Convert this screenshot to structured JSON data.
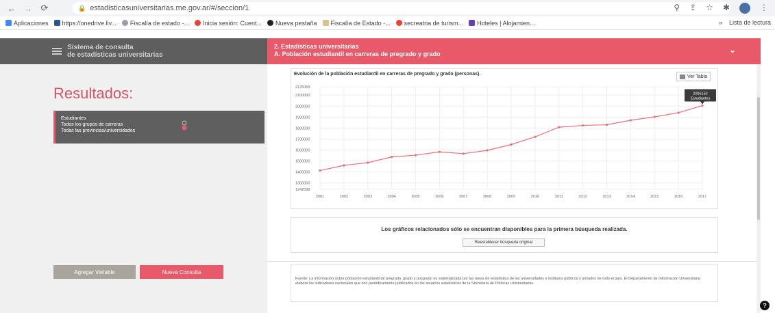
{
  "browser": {
    "url": "estadisticasuniversitarias.me.gov.ar/#/seccion/1",
    "bookmarks": [
      "Aplicaciones",
      "https://onedrive.liv...",
      "Fiscalía de estado -...",
      "Inicia sesión: Cuent...",
      "Nueva pestaña",
      "Fiscalía de Estado -...",
      "secreatria de turism...",
      "Hoteles | Alojamien..."
    ],
    "reading_list": "Lista de lectura",
    "more_bookmarks": "»"
  },
  "header": {
    "title_line1": "Sistema de consulta",
    "title_line2": "de estadísticas universitarias",
    "section_line1": "2. Estadísticas universitarias",
    "section_line2": "A. Población estudiantil en carreras de pregrado y grado",
    "chevron": "⌄"
  },
  "sidebar": {
    "title": "Resultados:",
    "filter_lines": [
      "Estudiantes",
      "Todos los grupos de carreras",
      "Todas las provincias/universidades"
    ],
    "add_variable": "Agregar Variable",
    "new_query": "Nueva Consulta"
  },
  "chart_card": {
    "title": "Evolución de la población estudiantil en carreras de pregrado y grado (personas).",
    "ver_tabla": "Ver Tabla"
  },
  "chart_data": {
    "type": "line",
    "x": [
      "2001",
      "2002",
      "2003",
      "2004",
      "2005",
      "2006",
      "2007",
      "2008",
      "2009",
      "2010",
      "2011",
      "2012",
      "2013",
      "2014",
      "2015",
      "2016",
      "2017"
    ],
    "series": [
      {
        "name": "Estudiantes",
        "values": [
          1412999,
          1460000,
          1485000,
          1537000,
          1553000,
          1583000,
          1567000,
          1597000,
          1650000,
          1720000,
          1808000,
          1824000,
          1830000,
          1871000,
          1902000,
          1940000,
          2005152
        ]
      }
    ],
    "ylim": [
      1242098,
      2176059
    ],
    "yticks": [
      "2176059",
      "2100000",
      "2000000",
      "1900000",
      "1800000",
      "1700000",
      "1600000",
      "1500000",
      "1400000",
      "1300000",
      "1242098"
    ],
    "tooltip": {
      "value": "2005152",
      "label": "Estudiantes"
    },
    "grid": true,
    "line_color": "#e8707c"
  },
  "info": {
    "message": "Los gráficos relacionados sólo se encuentran disponibles para la primera búsqueda realizada.",
    "restore_button": "Reestablecer búsqueda original"
  },
  "source": {
    "text": "Fuente: La información sobre población estudiantil de pregrado, grado y posgrado es sistematizada por las áreas de estadística de las universidades e institutos públicos y privados de todo el país. El Departamento de Información Universitaria elabora los indicadores nacionales que son periódicamente publicados en los anuarios estadísticos de la Secretaría de Políticas Universitarias."
  },
  "help": "?"
}
